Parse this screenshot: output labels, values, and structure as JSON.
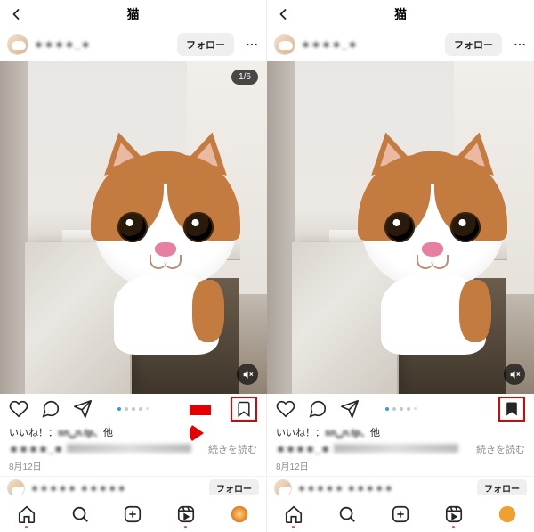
{
  "header": {
    "title": "猫"
  },
  "user": {
    "name": "＊＊＊＊_＊",
    "follow_label": "フォロー"
  },
  "post": {
    "counter": "1/6",
    "likes_prefix": "いいね！：",
    "likes_user": "sn␣n.tp、",
    "likes_suffix": "他",
    "caption_more": "続きを読む",
    "date": "8月12日"
  },
  "next_user": {
    "name": "＊＊＊＊＊ ＊＊＊＊＊",
    "follow_label": "フォロー"
  },
  "icons": {
    "back": "chevron-left",
    "like": "heart",
    "comment": "speech-bubble",
    "share": "paper-plane",
    "bookmark_outline": "bookmark-outline",
    "bookmark_filled": "bookmark-filled",
    "mute": "speaker-mute",
    "home": "home",
    "search": "magnify",
    "create": "plus-square",
    "reels": "reels",
    "profile": "profile-circle"
  }
}
